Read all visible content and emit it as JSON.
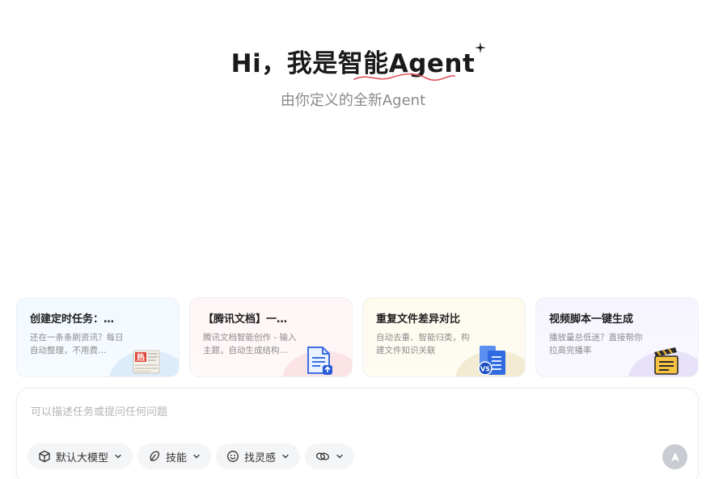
{
  "hero": {
    "title": "Hi，我是智能Agent",
    "subtitle": "由你定义的全新Agent"
  },
  "cards": [
    {
      "title": "创建定时任务：…",
      "desc": "还在一条条刷资讯？每日自动整理，不用费…",
      "icon": "hot-news-icon"
    },
    {
      "title": "【腾讯文档】一…",
      "desc": "腾讯文档智能创作 - 输入主题，自动生成结构…",
      "icon": "document-upload-icon"
    },
    {
      "title": "重复文件差异对比",
      "desc": "自动去重、智能归类，构建文件知识关联",
      "icon": "file-compare-icon"
    },
    {
      "title": "视频脚本一键生成",
      "desc": "播放量总低迷？直接帮你拉高完播率",
      "icon": "clapperboard-icon"
    }
  ],
  "input": {
    "placeholder": "可以描述任务或提问任何问题"
  },
  "tools": {
    "model_label": "默认大模型",
    "skills_label": "技能",
    "inspiration_label": "找灵感"
  },
  "colors": {
    "accent_squiggle": "#e0545d",
    "send_button": "#c9ccd3"
  }
}
